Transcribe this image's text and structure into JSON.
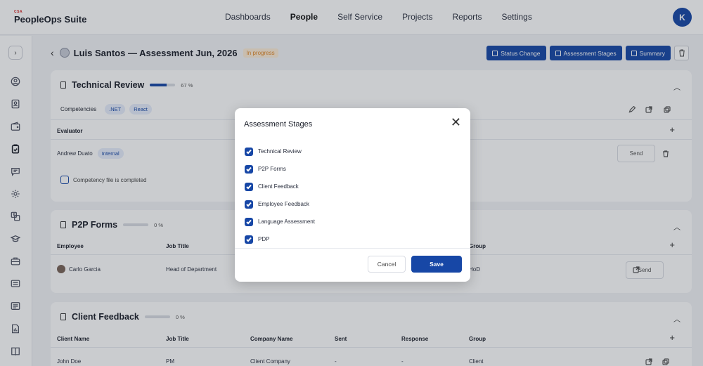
{
  "app": {
    "logo_mark": "CSA",
    "name": "PeopleOps Suite",
    "user_initial": "K"
  },
  "nav": [
    "Dashboards",
    "People",
    "Self Service",
    "Projects",
    "Reports",
    "Settings"
  ],
  "page": {
    "title": "Luis Santos  —  Assessment Jun, 2026",
    "status": "In progress",
    "actions": {
      "status_change": "Status Change",
      "stages": "Assessment Stages",
      "summary": "Summary"
    }
  },
  "technical_review": {
    "title": "Technical Review",
    "progress_label": "67 %",
    "progress": 0.67,
    "competencies_label": "Competencies",
    "tags": [
      ".NET",
      "React"
    ],
    "evaluator_header": "Evaluator",
    "evaluator_name": "Andrew Duato",
    "evaluator_tag": "Internal",
    "send": "Send",
    "checkbox_label": "Competency file is completed"
  },
  "p2p": {
    "title": "P2P Forms",
    "progress_label": "0 %",
    "progress": 0,
    "headers": {
      "employee": "Employee",
      "job": "Job Title",
      "group": "Group"
    },
    "row": {
      "employee": "Carlo Garcia",
      "job": "Head of Department",
      "group": "HoD"
    },
    "send": "Send"
  },
  "client": {
    "title": "Client Feedback",
    "progress_label": "0 %",
    "progress": 0,
    "headers": {
      "name": "Client Name",
      "job": "Job Title",
      "company": "Company Name",
      "sent": "Sent",
      "response": "Response",
      "group": "Group"
    },
    "row": {
      "name": "John Doe",
      "job": "PM",
      "company": "Client Company",
      "sent": "-",
      "response": "-",
      "group": "Client"
    }
  },
  "modal": {
    "title": "Assessment Stages",
    "items": [
      "Technical Review",
      "P2P Forms",
      "Client Feedback",
      "Employee Feedback",
      "Language Assessment",
      "PDP"
    ],
    "cancel": "Cancel",
    "save": "Save"
  }
}
